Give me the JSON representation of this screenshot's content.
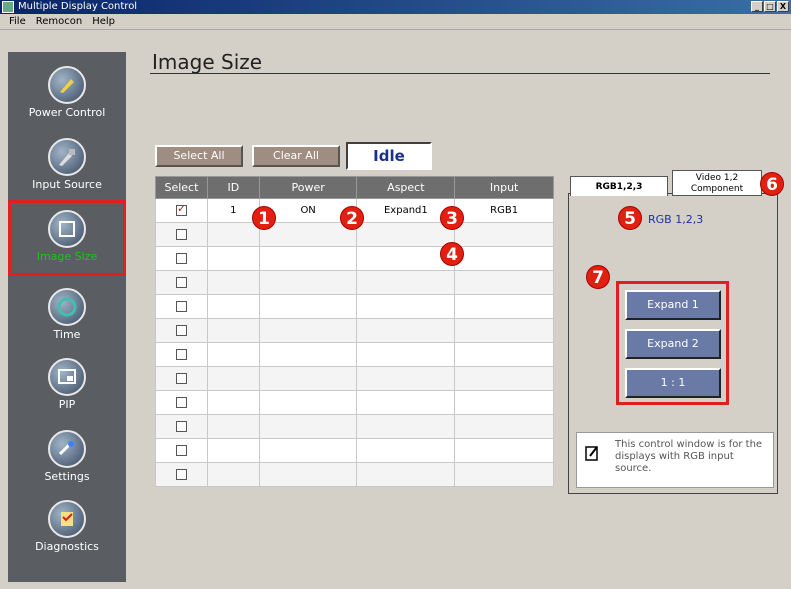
{
  "window": {
    "title": "Multiple Display Control",
    "buttons": [
      "_",
      "□",
      "X"
    ]
  },
  "menu": [
    "File",
    "Remocon",
    "Help"
  ],
  "sidebar": {
    "items": [
      {
        "label": "Power Control",
        "icon": "power-control-icon"
      },
      {
        "label": "Input Source",
        "icon": "input-source-icon"
      },
      {
        "label": "Image Size",
        "icon": "image-size-icon",
        "selected": true
      },
      {
        "label": "Time",
        "icon": "time-icon"
      },
      {
        "label": "PIP",
        "icon": "pip-icon"
      },
      {
        "label": "Settings",
        "icon": "settings-icon"
      },
      {
        "label": "Diagnostics",
        "icon": "diagnostics-icon"
      }
    ]
  },
  "main": {
    "title": "Image Size",
    "select_all": "Select All",
    "clear_all": "Clear All",
    "status": "Idle",
    "columns": [
      "Select",
      "ID",
      "Power",
      "Aspect",
      "Input"
    ],
    "rows": [
      {
        "checked": true,
        "id": "1",
        "power": "ON",
        "aspect": "Expand1",
        "input": "RGB1"
      },
      {
        "checked": false,
        "id": "",
        "power": "",
        "aspect": "",
        "input": ""
      },
      {
        "checked": false,
        "id": "",
        "power": "",
        "aspect": "",
        "input": ""
      },
      {
        "checked": false,
        "id": "",
        "power": "",
        "aspect": "",
        "input": ""
      },
      {
        "checked": false,
        "id": "",
        "power": "",
        "aspect": "",
        "input": ""
      },
      {
        "checked": false,
        "id": "",
        "power": "",
        "aspect": "",
        "input": ""
      },
      {
        "checked": false,
        "id": "",
        "power": "",
        "aspect": "",
        "input": ""
      },
      {
        "checked": false,
        "id": "",
        "power": "",
        "aspect": "",
        "input": ""
      },
      {
        "checked": false,
        "id": "",
        "power": "",
        "aspect": "",
        "input": ""
      },
      {
        "checked": false,
        "id": "",
        "power": "",
        "aspect": "",
        "input": ""
      },
      {
        "checked": false,
        "id": "",
        "power": "",
        "aspect": "",
        "input": ""
      },
      {
        "checked": false,
        "id": "",
        "power": "",
        "aspect": "",
        "input": ""
      }
    ]
  },
  "panel": {
    "tab_rgb": "RGB1,2,3",
    "tab_video_line1": "Video 1,2",
    "tab_video_line2": "Component",
    "heading": "RGB 1,2,3",
    "buttons": [
      "Expand 1",
      "Expand 2",
      "1 : 1"
    ],
    "note": "This control window is for the displays with RGB input source."
  },
  "badges": [
    "1",
    "2",
    "3",
    "4",
    "5",
    "6",
    "7"
  ],
  "colors": {
    "accent_red": "#e02010",
    "sidebar": "#5a5e62",
    "selected_label": "#20c020",
    "status_text": "#1b2f8f"
  }
}
